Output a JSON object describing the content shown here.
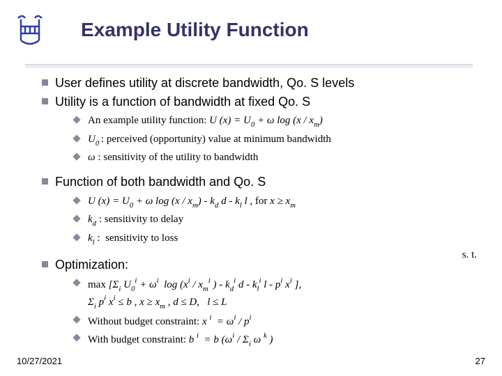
{
  "title": "Example Utility Function",
  "bullets": {
    "b1": "User defines utility at discrete bandwidth, Qo. S levels",
    "b2": "Utility is a function of bandwidth at fixed Qo. S",
    "b3": "Function of both bandwidth and Qo. S",
    "b4": "Optimization:"
  },
  "sub1": {
    "s1_pre": "An example utility function: ",
    "s1_eq": "U (x) = U₀ + ω log (x / xₘ)",
    "s2_lbl": "U₀ : ",
    "s2_txt": "perceived (opportunity) value at minimum bandwidth",
    "s3_lbl": "ω : ",
    "s3_txt": "sensitivity of the utility to bandwidth"
  },
  "sub2": {
    "s1": "U (x) = U₀ + ω log (x / xₘ) - k_d d - k_l l , for x ≥ xₘ",
    "s2_lbl": "k_d : ",
    "s2_txt": "sensitivity to delay",
    "s3_lbl": "k_l : ",
    "s3_txt": "sensitivity to loss"
  },
  "sub3": {
    "s1a": "max [Σᵢ U₀ⁱ + ωⁱ  log (xⁱ / xₘⁱ ) - k_dⁱ d - k_lⁱ l - pⁱ xⁱ ],",
    "s1b": "Σᵢ pⁱ xⁱ ≤ b , x ≥ xₘ , d ≤ D,   l ≤ L",
    "s2_pre": "Without budget constraint: ",
    "s2_eq": "x ⁱ  = ωⁱ / pⁱ",
    "s3_pre": "With budget constraint: ",
    "s3_eq": "b ⁱ  = b (ωⁱ / Σᵢ ω ᵏ )"
  },
  "st_label": "s. t.",
  "footer": {
    "date": "10/27/2021",
    "page": "27"
  }
}
